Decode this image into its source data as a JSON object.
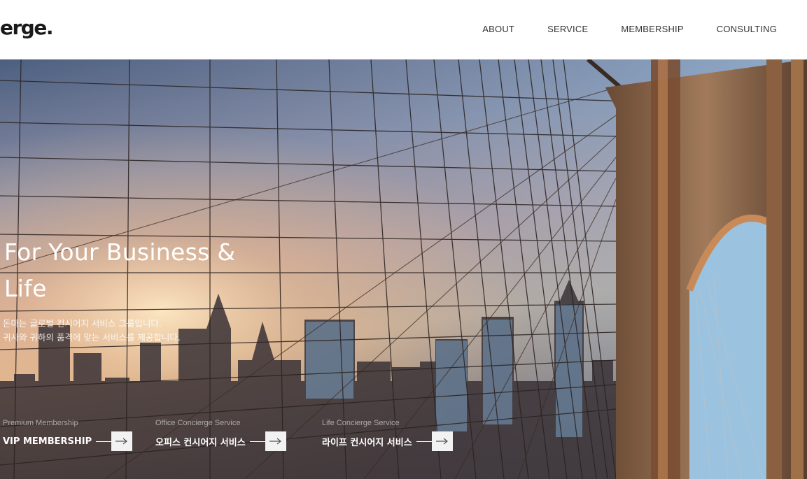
{
  "header": {
    "logo": "erge.",
    "nav": [
      "ABOUT",
      "SERVICE",
      "MEMBERSHIP",
      "CONSULTING"
    ]
  },
  "hero": {
    "headline": [
      "For Your Business &",
      "Life"
    ],
    "description": [
      "돈마는 글로벌 컨시어지 서비스 그룹입니다.",
      "귀사와 귀하의 품격에 맞는 서비스를 제공합니다."
    ],
    "links": [
      {
        "sub": "Premium Membership",
        "label": "VIP MEMBERSHIP"
      },
      {
        "sub": "Office Concierge Service",
        "label": "오피스 컨시어지 서비스"
      },
      {
        "sub": "Life Concierge Service",
        "label": "라이프 컨시어지 서비스"
      }
    ]
  },
  "colors": {
    "accent": "#ffffff",
    "button_bg": "#f2f2f2",
    "text_dark": "#222222"
  }
}
